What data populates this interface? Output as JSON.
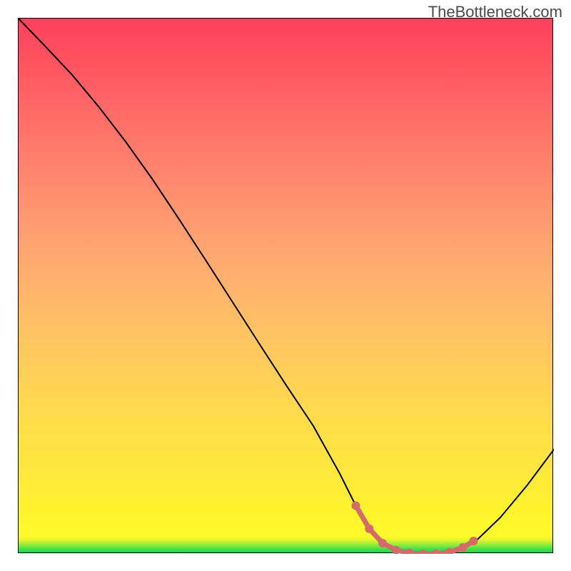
{
  "attribution": "TheBottleneck.com",
  "chart_data": {
    "type": "line",
    "x": [
      0.0,
      0.05,
      0.1,
      0.15,
      0.2,
      0.25,
      0.3,
      0.35,
      0.4,
      0.45,
      0.5,
      0.55,
      0.6,
      0.63,
      0.65,
      0.68,
      0.72,
      0.76,
      0.8,
      0.82,
      0.85,
      0.9,
      0.95,
      1.0
    ],
    "y": [
      1.0,
      0.948,
      0.895,
      0.835,
      0.77,
      0.7,
      0.625,
      0.548,
      0.47,
      0.392,
      0.315,
      0.24,
      0.15,
      0.09,
      0.05,
      0.02,
      0.005,
      0.0,
      0.0,
      0.005,
      0.02,
      0.068,
      0.128,
      0.195
    ],
    "optimal_region_x": [
      0.63,
      0.85
    ],
    "optimal_region_points": [
      {
        "x": 0.63,
        "y": 0.09
      },
      {
        "x": 0.655,
        "y": 0.047
      },
      {
        "x": 0.68,
        "y": 0.02
      },
      {
        "x": 0.705,
        "y": 0.007
      },
      {
        "x": 0.73,
        "y": 0.002
      },
      {
        "x": 0.755,
        "y": 0.0
      },
      {
        "x": 0.78,
        "y": 0.0
      },
      {
        "x": 0.805,
        "y": 0.003
      },
      {
        "x": 0.83,
        "y": 0.012
      },
      {
        "x": 0.85,
        "y": 0.024
      }
    ],
    "title": "",
    "xlabel": "",
    "ylabel": "",
    "xlim": [
      0,
      1
    ],
    "ylim": [
      0,
      1
    ]
  }
}
